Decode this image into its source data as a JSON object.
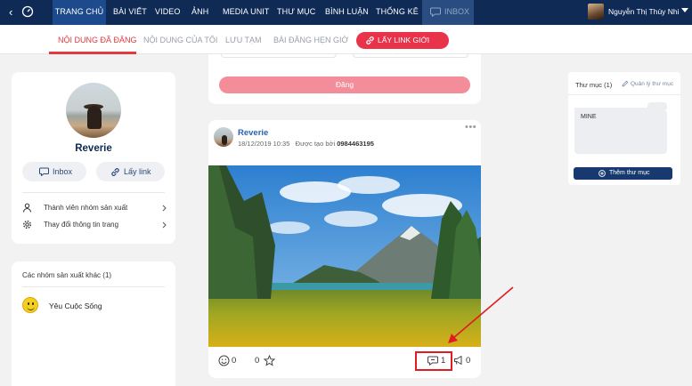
{
  "nav": {
    "tabs": [
      {
        "label": "TRANG CHỦ",
        "active": true
      },
      {
        "label": "BÀI VIẾT",
        "active": false
      },
      {
        "label": "VIDEO",
        "active": false
      },
      {
        "label": "ẢNH",
        "active": false
      },
      {
        "label": "MEDIA UNIT",
        "active": false
      },
      {
        "label": "THƯ MỤC",
        "active": false
      },
      {
        "label": "BÌNH LUẬN",
        "active": false
      },
      {
        "label": "THỐNG KÊ",
        "active": false
      }
    ],
    "inbox_label": "INBOX",
    "user_name": "Nguyễn Thị Thùy Nhi"
  },
  "subnav": {
    "tabs": [
      {
        "label": "NỘI DUNG ĐÃ ĐĂNG",
        "active": true
      },
      {
        "label": "NỘI DUNG CỦA TÔI",
        "active": false
      },
      {
        "label": "LƯU TẠM",
        "active": false
      },
      {
        "label": "BÀI ĐĂNG HẸN GIỜ",
        "active": false
      }
    ],
    "link_button": "LẤY LINK GIỚI THIỆU"
  },
  "profile": {
    "name": "Reverie",
    "inbox_button": "Inbox",
    "link_button": "Lấy link",
    "menu": [
      {
        "label": "Thành viên nhóm sản xuất",
        "icon": "person-icon"
      },
      {
        "label": "Thay đổi thông tin trang",
        "icon": "gear-icon"
      }
    ]
  },
  "groups": {
    "title": "Các nhóm sản xuất khác",
    "count": "(1)",
    "items": [
      {
        "name": "Yêu Cuộc Sống",
        "icon": "smiley-icon"
      }
    ]
  },
  "composer": {
    "post_button": "Đăng"
  },
  "post": {
    "author": "Reverie",
    "time": "18/12/2019 10:35",
    "created_by_label": "Được tạo bởi",
    "created_by": "0984463195",
    "more": "•••",
    "reactions": "0",
    "stars": "0",
    "comments": "1",
    "shares": "0"
  },
  "folders": {
    "title": "Thư mục",
    "count": "(1)",
    "manage": "Quản lý thư mục",
    "items": [
      "MINE"
    ],
    "add_button": "Thêm thư mục"
  },
  "colors": {
    "navbar": "#0e2a55",
    "accent_red": "#e0393e",
    "link_blue": "#2a62b4",
    "highlight": "#e11b22"
  }
}
